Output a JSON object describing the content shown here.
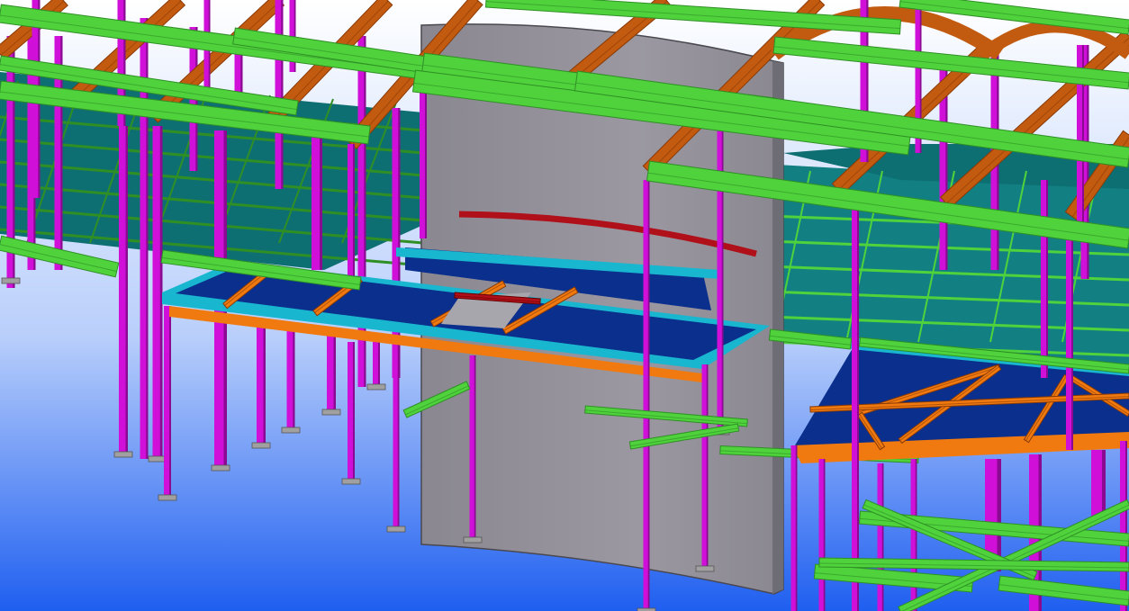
{
  "viewport": {
    "view_type": "3D structural model view",
    "background": {
      "top": "#ffffff",
      "mid": "#b9cffb",
      "bottom": "#1f5ff0"
    }
  },
  "palette": {
    "column": "#d010d8",
    "column_dark": "#8a0a92",
    "beam_green": "#4fd23c",
    "beam_green_dark": "#2f8f25",
    "rafter": "#c25a10",
    "rafter_dark": "#8a3a05",
    "floor_teal": "#0e6f72",
    "floor_teal_light": "#128082",
    "deck_blue": "#0a2f8c",
    "deck_cyan": "#19b6cf",
    "edge_orange": "#f07a10",
    "wall_gray": "#8a8790",
    "wall_gray_light": "#9b98a1",
    "curb_red": "#b0101a",
    "plate": "#a0a0a0"
  },
  "model_parts": [
    "curved-concrete-wall",
    "steel-columns",
    "green-steel-beams",
    "roof-rafters",
    "floor-slabs",
    "elevated-deck-platform",
    "fan-shaped-deck",
    "base-plates"
  ]
}
